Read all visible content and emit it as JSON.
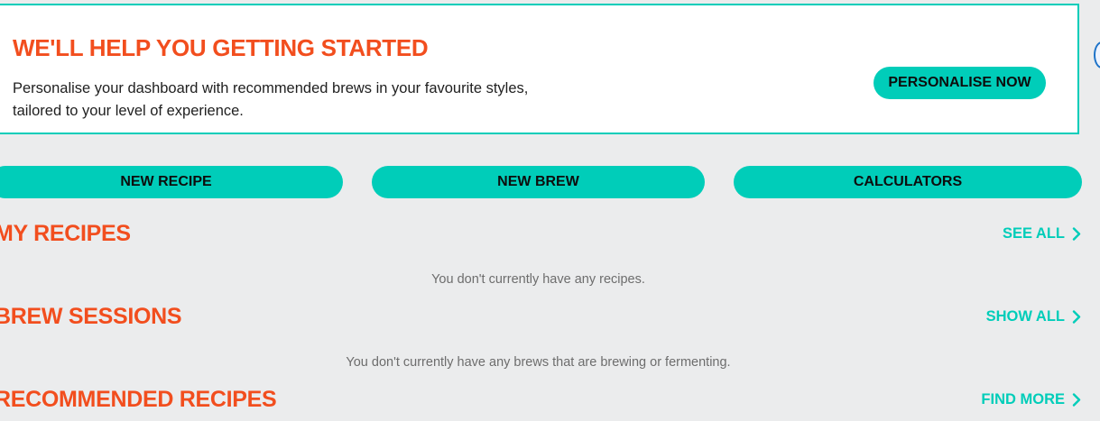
{
  "banner": {
    "title": "WE'LL HELP YOU GETTING STARTED",
    "text_line1": "Personalise your dashboard with recommended brews in your favourite styles,",
    "text_line2": "tailored to your level of experience.",
    "button_label": "PERSONALISE NOW"
  },
  "actions": {
    "new_recipe": "NEW RECIPE",
    "new_brew": "NEW BREW",
    "calculators": "CALCULATORS"
  },
  "sections": {
    "my_recipes": {
      "title": "MY RECIPES",
      "link": "SEE ALL",
      "empty": "You don't currently have any recipes."
    },
    "brew_sessions": {
      "title": "BREW SESSIONS",
      "link": "SHOW ALL",
      "empty": "You don't currently have any brews that are brewing or fermenting."
    },
    "recommended_recipes": {
      "title": "RECOMMENDED RECIPES",
      "link": "FIND MORE"
    }
  },
  "colors": {
    "accent": "#00cdb9",
    "heading": "#f24e1e",
    "background": "#ebeced"
  }
}
